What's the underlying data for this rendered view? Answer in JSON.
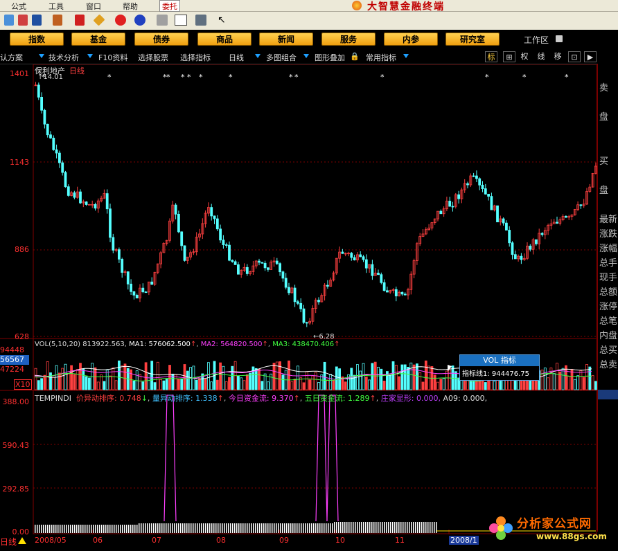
{
  "menu": {
    "items": [
      "公式",
      "工具",
      "窗口",
      "帮助"
    ],
    "weituo": "委托",
    "app_title": "大智慧金融终端"
  },
  "nav": {
    "buttons": [
      "指数",
      "基金",
      "债券",
      "商品",
      "新闻",
      "服务",
      "内参",
      "研究室"
    ],
    "workarea": "工作区"
  },
  "chart_toolbar": {
    "items": [
      "认方案",
      "技术分析",
      "F10资料",
      "选择股票",
      "选择指标",
      "日线",
      "多图组合",
      "图形叠加",
      "常用指标"
    ],
    "right_buttons": [
      "标",
      "⊞",
      "权",
      "线",
      "移",
      "⊡",
      "▶"
    ]
  },
  "stock": {
    "name": "保利地产",
    "period": "日线",
    "high_label": "14.01",
    "low_label": "6.28",
    "price_axis": [
      "1401",
      "1143",
      "886",
      "628"
    ]
  },
  "vol": {
    "legend_label": "VOL(5,10,20)",
    "value": "813922.563",
    "ma1_label": "MA1:",
    "ma1": "576062.500",
    "ma2_label": "MA2:",
    "ma2": "564820.500",
    "ma3_label": "MA3:",
    "ma3": "438470.406",
    "axis": [
      "94448",
      "56567",
      "47224",
      "X10"
    ]
  },
  "tooltip": {
    "title": "VOL 指标",
    "line_label": "指标线1:",
    "line_value": "944476.75"
  },
  "tempindi": {
    "name": "TEMPINDI",
    "items": [
      {
        "label": "价异动排序:",
        "value": "0.748",
        "arrow": "↓"
      },
      {
        "label": "量异动排序:",
        "value": "1.338",
        "arrow": "↑"
      },
      {
        "label": "今日资金流:",
        "value": "9.370",
        "arrow": "↑"
      },
      {
        "label": "五日资金流:",
        "value": "1.289",
        "arrow": "↑"
      },
      {
        "label": "庄家显形:",
        "value": "0.000,",
        "arrow": ""
      },
      {
        "label": "A09:",
        "value": "0.000,",
        "arrow": ""
      }
    ],
    "axis": [
      "388.00",
      "590.43",
      "292.85",
      "0.00"
    ]
  },
  "x_axis": [
    "2008/05",
    "06",
    "07",
    "08",
    "09",
    "10",
    "11",
    "2008/1"
  ],
  "bottom_tab": "日线",
  "right_panel": [
    "卖",
    "盘",
    "买",
    "盘",
    "最新",
    "涨跌",
    "涨幅",
    "总手",
    "现手",
    "总额",
    "涨停",
    "总笔",
    "内盘",
    "总买",
    "总卖"
  ],
  "watermark": {
    "title": "分析家公式网",
    "url": "www.88gs.com"
  },
  "colors": {
    "up": "#ff4040",
    "down": "#54ffff",
    "grid": "#800000",
    "ma1": "#ffffff",
    "ma2": "#ff40ff",
    "ma3": "#40ff40",
    "pulse": "#ff40ff"
  }
}
